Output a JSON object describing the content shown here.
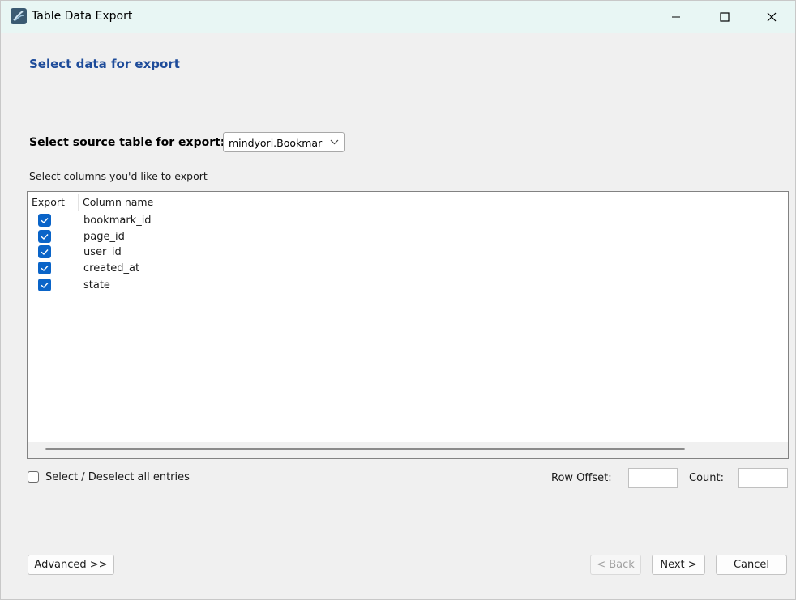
{
  "window": {
    "title": "Table Data Export",
    "icon": "mysql-workbench-icon",
    "controls": [
      "minimize-icon",
      "maximize-icon",
      "close-icon"
    ]
  },
  "heading": "Select data for export",
  "source": {
    "label": "Select source table for export:",
    "selected": "mindyori.Bookmar"
  },
  "columns_label": "Select columns you'd like to export",
  "table": {
    "headers": {
      "export": "Export",
      "column_name": "Column name"
    },
    "rows": [
      {
        "name": "bookmark_id",
        "checked": true
      },
      {
        "name": "page_id",
        "checked": true
      },
      {
        "name": "user_id",
        "checked": true
      },
      {
        "name": "created_at",
        "checked": true
      },
      {
        "name": "state",
        "checked": true
      }
    ]
  },
  "select_all": {
    "label": "Select / Deselect all entries",
    "checked": false
  },
  "row_offset": {
    "label": "Row Offset:",
    "value": ""
  },
  "count": {
    "label": "Count:",
    "value": ""
  },
  "buttons": {
    "advanced": "Advanced >>",
    "back": "< Back",
    "next": "Next >",
    "cancel": "Cancel"
  },
  "colors": {
    "accent": "#0a64c8",
    "heading": "#1e4c9a",
    "titlebar": "#e8f6f4"
  }
}
